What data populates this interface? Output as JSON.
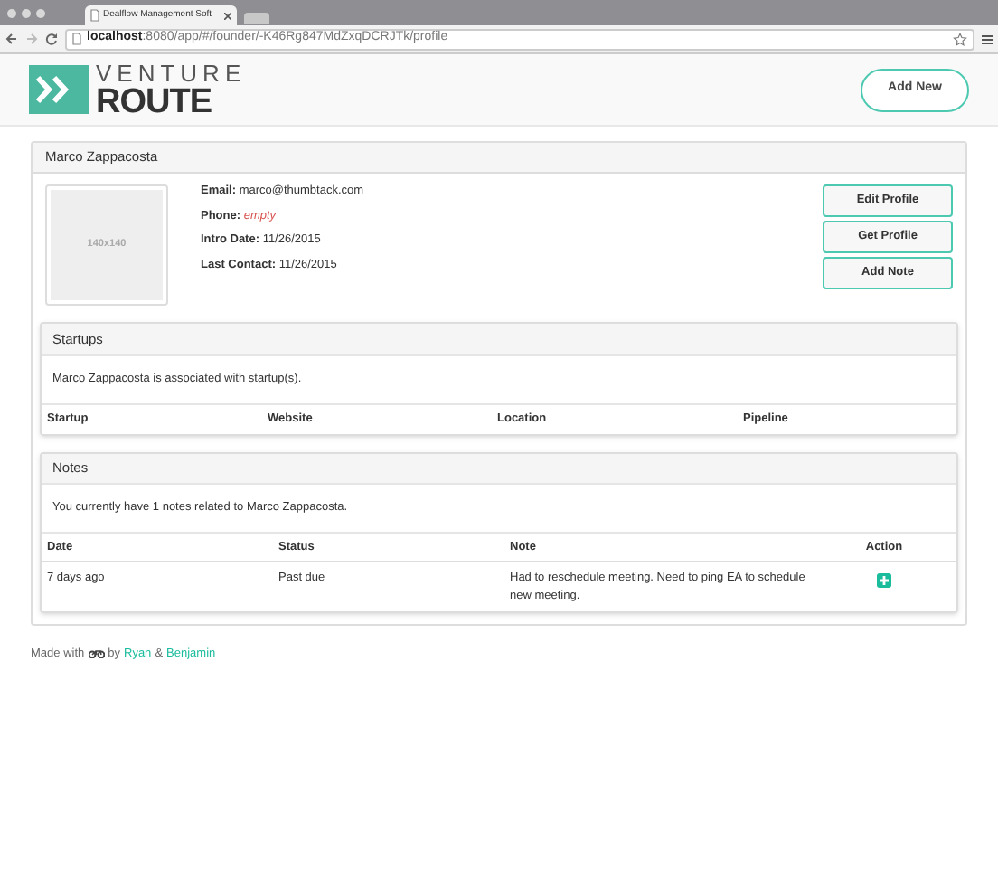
{
  "browser": {
    "tab_title": "Dealflow Management Soft",
    "address_host": "localhost",
    "address_path": ":8080/app/#/founder/-K46Rg847MdZxqDCRJTk/profile"
  },
  "header": {
    "logo_top": "VENTURE",
    "logo_bottom": "ROUTE",
    "add_button": "Add New"
  },
  "profile": {
    "name": "Marco Zappacosta",
    "photo_label": "140x140",
    "fields": [
      {
        "label": "Email:",
        "value": "marco@thumbtack.com",
        "empty": false
      },
      {
        "label": "Phone:",
        "value": "empty",
        "empty": true
      },
      {
        "label": "Intro Date:",
        "value": "11/26/2015",
        "empty": false
      },
      {
        "label": "Last Contact:",
        "value": "11/26/2015",
        "empty": false
      }
    ],
    "buttons": [
      "Edit Profile",
      "Get Profile",
      "Add Note"
    ]
  },
  "startups": {
    "title": "Startups",
    "text": "Marco Zappacosta is associated with startup(s).",
    "columns": [
      "Startup",
      "Website",
      "Location",
      "Pipeline"
    ]
  },
  "notes": {
    "title": "Notes",
    "text": "You currently have 1 notes related to Marco Zappacosta.",
    "columns": [
      "Date",
      "Status",
      "Note",
      "Action"
    ],
    "rows": [
      {
        "date": "7 days ago",
        "status": "Past due",
        "note": "Had to reschedule meeting. Need to ping EA to schedule new meeting."
      }
    ]
  },
  "footer": {
    "made_with": "Made with",
    "by": "by",
    "author_1": "Ryan",
    "amp": "&",
    "author_2": "Benjamin"
  }
}
